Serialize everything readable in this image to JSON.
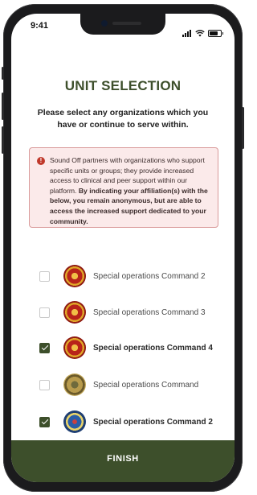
{
  "status_bar": {
    "time": "9:41"
  },
  "page": {
    "title": "UNIT SELECTION",
    "subtitle": "Please select any organizations which you have or continue to serve within."
  },
  "notice": {
    "text_normal": "Sound Off partners with organizations who support specific units or groups; they provide increased access to clinical and peer support within our platform. ",
    "text_bold": "By indicating your affiliation(s) with the below, you remain anonymous, but are able to access the increased support dedicated to your community."
  },
  "units": [
    {
      "label": "Special operations Command 2",
      "checked": false,
      "emblem": "red"
    },
    {
      "label": "Special operations Command 3",
      "checked": false,
      "emblem": "red"
    },
    {
      "label": "Special operations Command 4",
      "checked": true,
      "emblem": "red"
    },
    {
      "label": "Special operations Command",
      "checked": false,
      "emblem": "gold"
    },
    {
      "label": "Special operations Command 2",
      "checked": true,
      "emblem": "blue"
    }
  ],
  "footer": {
    "finish_label": "FINISH"
  },
  "colors": {
    "accent": "#3d4f2b",
    "notice_bg": "#fbeaea",
    "notice_border": "#d99a9a",
    "info_icon": "#c0392b"
  }
}
